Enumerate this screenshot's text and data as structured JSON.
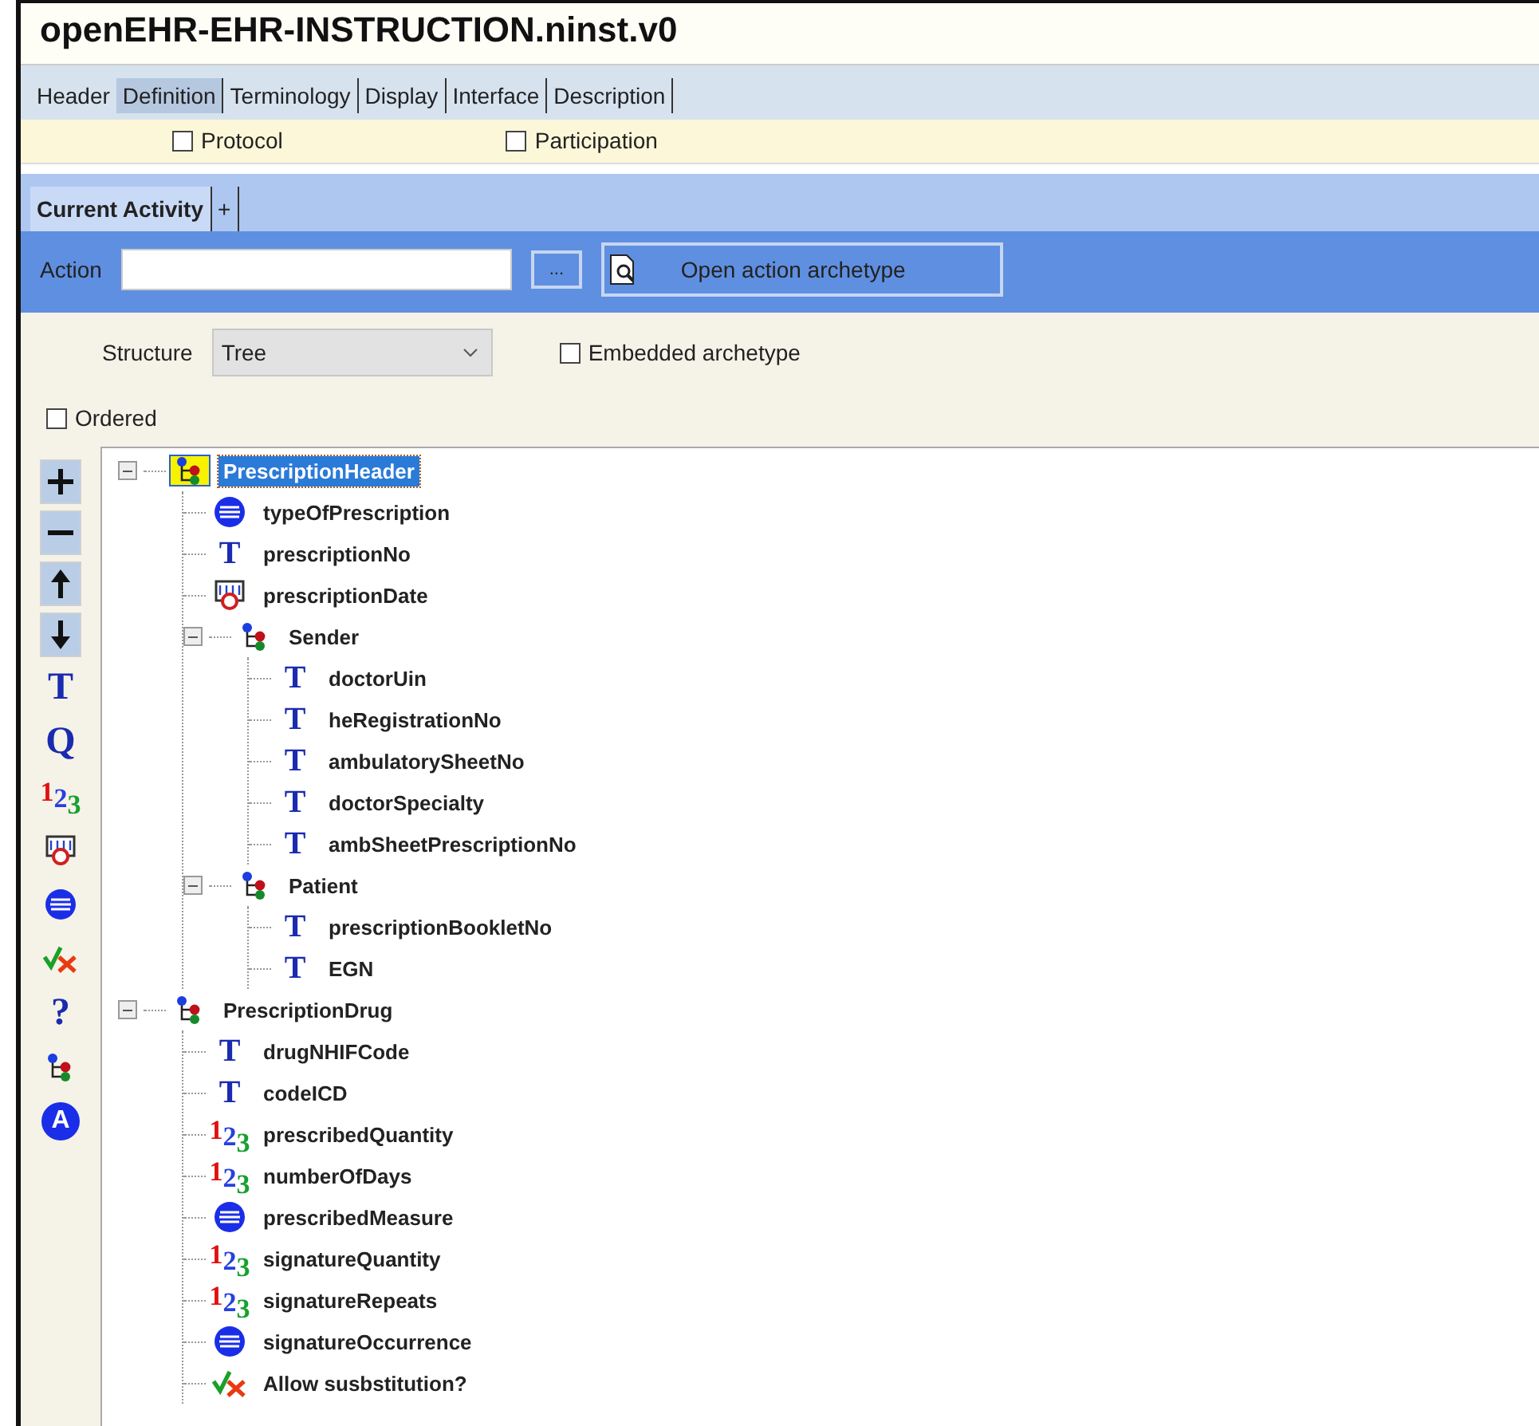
{
  "window": {
    "title": "openEHR-EHR-INSTRUCTION.ninst.v0"
  },
  "tabs": [
    {
      "label": "Header",
      "selected": false
    },
    {
      "label": "Definition",
      "selected": true
    },
    {
      "label": "Terminology",
      "selected": false
    },
    {
      "label": "Display",
      "selected": false
    },
    {
      "label": "Interface",
      "selected": false
    },
    {
      "label": "Description",
      "selected": false
    }
  ],
  "options": [
    {
      "label": "Protocol",
      "checked": false
    },
    {
      "label": "Participation",
      "checked": false
    }
  ],
  "activity_tabs": [
    {
      "label": "Current Activity",
      "selected": true
    },
    {
      "label": "+",
      "selected": false
    }
  ],
  "action": {
    "label": "Action",
    "browse_button": "...",
    "open_button": "Open action archetype"
  },
  "structure": {
    "label": "Structure",
    "value": "Tree",
    "embedded": {
      "label": "Embedded archetype",
      "checked": false
    }
  },
  "ordered": {
    "label": "Ordered",
    "checked": false
  },
  "toolbar": [
    {
      "kind": "add"
    },
    {
      "kind": "remove"
    },
    {
      "kind": "up"
    },
    {
      "kind": "down"
    },
    {
      "kind": "glyph",
      "glyph": "T"
    },
    {
      "kind": "glyph",
      "glyph": "Q"
    },
    {
      "kind": "count",
      "glyph": "123"
    },
    {
      "kind": "datetime"
    },
    {
      "kind": "coded"
    },
    {
      "kind": "boolean"
    },
    {
      "kind": "glyph",
      "glyph": "?"
    },
    {
      "kind": "cluster"
    },
    {
      "kind": "any",
      "glyph": "A"
    }
  ],
  "tree": [
    {
      "label": "PrescriptionHeader",
      "kind": "cluster",
      "selected": true,
      "expanded": true,
      "children": [
        {
          "label": "typeOfPrescription",
          "kind": "coded",
          "selected": false
        },
        {
          "label": "prescriptionNo",
          "kind": "text",
          "glyph": "T",
          "selected": false
        },
        {
          "label": "prescriptionDate",
          "kind": "datetime",
          "selected": false
        },
        {
          "label": "Sender",
          "kind": "cluster",
          "selected": false,
          "expanded": true,
          "children": [
            {
              "label": "doctorUin",
              "kind": "text",
              "glyph": "T",
              "selected": false
            },
            {
              "label": "heRegistrationNo",
              "kind": "text",
              "glyph": "T",
              "selected": false
            },
            {
              "label": "ambulatorySheetNo",
              "kind": "text",
              "glyph": "T",
              "selected": false
            },
            {
              "label": "doctorSpecialty",
              "kind": "text",
              "glyph": "T",
              "selected": false
            },
            {
              "label": "ambSheetPrescriptionNo",
              "kind": "text",
              "glyph": "T",
              "selected": false
            }
          ]
        },
        {
          "label": "Patient",
          "kind": "cluster",
          "selected": false,
          "expanded": true,
          "children": [
            {
              "label": "prescriptionBookletNo",
              "kind": "text",
              "glyph": "T",
              "selected": false
            },
            {
              "label": "EGN",
              "kind": "text",
              "glyph": "T",
              "selected": false
            }
          ]
        }
      ]
    },
    {
      "label": "PrescriptionDrug",
      "kind": "cluster",
      "selected": false,
      "expanded": true,
      "children": [
        {
          "label": "drugNHIFCode",
          "kind": "text",
          "glyph": "T",
          "selected": false
        },
        {
          "label": "codeICD",
          "kind": "text",
          "glyph": "T",
          "selected": false
        },
        {
          "label": "prescribedQuantity",
          "kind": "count",
          "glyph": "123",
          "selected": false
        },
        {
          "label": "numberOfDays",
          "kind": "count",
          "glyph": "123",
          "selected": false
        },
        {
          "label": "prescribedMeasure",
          "kind": "coded",
          "selected": false
        },
        {
          "label": "signatureQuantity",
          "kind": "count",
          "glyph": "123",
          "selected": false
        },
        {
          "label": "signatureRepeats",
          "kind": "count",
          "glyph": "123",
          "selected": false
        },
        {
          "label": "signatureOccurrence",
          "kind": "coded",
          "selected": false
        },
        {
          "label": "Allow susbstitution?",
          "kind": "boolean",
          "selected": false
        }
      ]
    }
  ]
}
